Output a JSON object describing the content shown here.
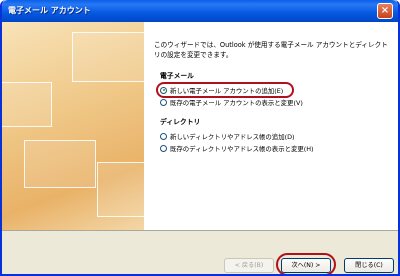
{
  "window": {
    "title": "電子メール アカウント",
    "close_label": "×"
  },
  "intro": "このウィザードでは、Outlook が使用する電子メール アカウントとディレクトリの設定を変更できます。",
  "email_section": {
    "label": "電子メール",
    "options": [
      {
        "label": "新しい電子メール アカウントの追加(E)",
        "selected": true
      },
      {
        "label": "既存の電子メール アカウントの表示と変更(V)",
        "selected": false
      }
    ]
  },
  "directory_section": {
    "label": "ディレクトリ",
    "options": [
      {
        "label": "新しいディレクトリやアドレス帳の追加(D)",
        "selected": false
      },
      {
        "label": "既存のディレクトリやアドレス帳の表示と変更(H)",
        "selected": false
      }
    ]
  },
  "buttons": {
    "back": "< 戻る(B)",
    "next": "次へ(N) >",
    "close": "閉じる(C)"
  },
  "colors": {
    "titlebar": "#0558e0",
    "highlight": "#b0101c",
    "art_bg": "#f0c98a"
  }
}
